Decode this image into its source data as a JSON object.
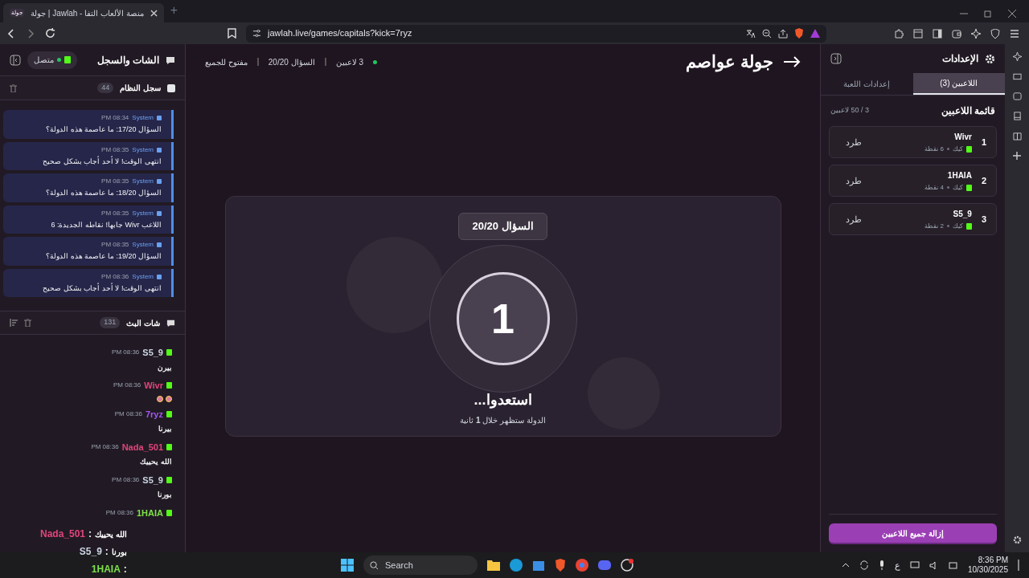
{
  "browser": {
    "tab_title": "جولة | Jawlah - منصة الألعاب التفا",
    "tab_badge": "جولة",
    "new_tab": "+",
    "url": "jawlah.live/games/capitals?kick=7ryz"
  },
  "chat_panel": {
    "title": "الشات والسجل",
    "status": "متصل",
    "connected": true,
    "system_log": {
      "title": "سجل النظام",
      "count": "44",
      "messages": [
        {
          "sender": "System",
          "time": "PM 08:34",
          "text": "السؤال 17/20: ما عاصمة هذه الدولة؟"
        },
        {
          "sender": "System",
          "time": "PM 08:35",
          "text": "انتهى الوقت! لا أحد أجاب بشكل صحيح"
        },
        {
          "sender": "System",
          "time": "PM 08:35",
          "text": "السؤال 18/20: ما عاصمة هذه الدولة؟"
        },
        {
          "sender": "System",
          "time": "PM 08:35",
          "text": "اللاعب Wivr جابها! نقاطه الجديدة: 6"
        },
        {
          "sender": "System",
          "time": "PM 08:35",
          "text": "السؤال 19/20: ما عاصمة هذه الدولة؟"
        },
        {
          "sender": "System",
          "time": "PM 08:36",
          "text": "انتهى الوقت! لا أحد أجاب بشكل صحيح"
        }
      ]
    },
    "stream_chat": {
      "title": "شات البث",
      "count": "131",
      "messages": [
        {
          "kind": "text",
          "user": "S5_9",
          "color": "#cbd5e1",
          "time": "PM 08:36",
          "text": "بيرن"
        },
        {
          "kind": "emoji",
          "user": "Wivr",
          "color": "#e0457b",
          "time": "PM 08:36"
        },
        {
          "kind": "text",
          "user": "7ryz",
          "color": "#a855f7",
          "time": "PM 08:36",
          "text": "بيرنا"
        },
        {
          "kind": "text",
          "user": "Nada_501",
          "color": "#e0457b",
          "time": "PM 08:36",
          "text": "الله يحييك"
        },
        {
          "kind": "text",
          "user": "S5_9",
          "color": "#cbd5e1",
          "time": "PM 08:36",
          "text": "بورنا"
        },
        {
          "kind": "text",
          "user": "1HAIA",
          "color": "#7ee04a",
          "time": "PM 08:36"
        }
      ]
    }
  },
  "stream_overlay": [
    {
      "user": "Nada_501",
      "separator": ":",
      "color": "#e0457b",
      "text": "الله يحييك"
    },
    {
      "user": "S5_9",
      "separator": ":",
      "color": "#cbd5e1",
      "text": "بورنا"
    },
    {
      "user": "1HAIA",
      "separator": ":",
      "color": "#7ee04a"
    }
  ],
  "game": {
    "title": "جولة عواصم",
    "players": "3 لاعبين",
    "question": "السؤال 20/20",
    "access": "مفتوح للجميع",
    "card": {
      "badge": "السؤال 20/20",
      "countdown": "1",
      "heading": "استعدوا...",
      "subtitle": "الدولة ستظهر خلال **1** ثانية"
    }
  },
  "settings": {
    "title": "الإعدادات",
    "tabs": [
      {
        "label": "اللاعبين (3)",
        "selected": true
      },
      {
        "label": "إعدادات اللعبة",
        "selected": false
      }
    ],
    "list_title": "قائمة اللاعبين",
    "capacity": "3 / 50 لاعبين",
    "players": [
      {
        "rank": "1",
        "name": "Wivr",
        "platform": "كيك",
        "points": "6 نقطة",
        "action": "طرد"
      },
      {
        "rank": "2",
        "name": "1HAIA",
        "platform": "كيك",
        "points": "4 نقطة",
        "action": "طرد"
      },
      {
        "rank": "3",
        "name": "S5_9",
        "platform": "كيك",
        "points": "2 نقطة",
        "action": "طرد"
      }
    ],
    "remove_all": "إزالة جميع اللاعبين"
  },
  "taskbar": {
    "search": "Search",
    "language": "ع",
    "time": "8:36 PM",
    "date": "10/30/2025"
  }
}
